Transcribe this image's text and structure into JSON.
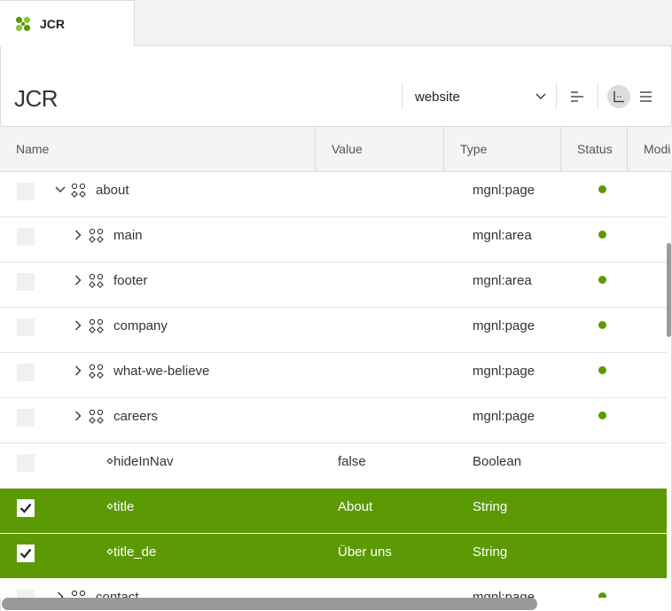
{
  "tab": {
    "label": "JCR"
  },
  "page": {
    "title": "JCR"
  },
  "toolbar": {
    "workspace": "website"
  },
  "columns": [
    "Name",
    "Value",
    "Type",
    "Status",
    "Modi"
  ],
  "rows": [
    {
      "name": "about",
      "value": "",
      "type": "mgnl:page",
      "status": true,
      "kind": "node",
      "level": 0,
      "expanded": true,
      "selected": false
    },
    {
      "name": "main",
      "value": "",
      "type": "mgnl:area",
      "status": true,
      "kind": "node",
      "level": 1,
      "expanded": false,
      "selected": false
    },
    {
      "name": "footer",
      "value": "",
      "type": "mgnl:area",
      "status": true,
      "kind": "node",
      "level": 1,
      "expanded": false,
      "selected": false
    },
    {
      "name": "company",
      "value": "",
      "type": "mgnl:page",
      "status": true,
      "kind": "node",
      "level": 1,
      "expanded": false,
      "selected": false
    },
    {
      "name": "what-we-believe",
      "value": "",
      "type": "mgnl:page",
      "status": true,
      "kind": "node",
      "level": 1,
      "expanded": false,
      "selected": false
    },
    {
      "name": "careers",
      "value": "",
      "type": "mgnl:page",
      "status": true,
      "kind": "node",
      "level": 1,
      "expanded": false,
      "selected": false
    },
    {
      "name": "hideInNav",
      "value": "false",
      "type": "Boolean",
      "status": false,
      "kind": "property",
      "level": 1,
      "selected": false
    },
    {
      "name": "title",
      "value": "About",
      "type": "String",
      "status": false,
      "kind": "property",
      "level": 1,
      "selected": true
    },
    {
      "name": "title_de",
      "value": "Über uns",
      "type": "String",
      "status": false,
      "kind": "property",
      "level": 1,
      "selected": true
    },
    {
      "name": "contact",
      "value": "",
      "type": "mgnl:page",
      "status": true,
      "kind": "node",
      "level": 0,
      "expanded": false,
      "selected": false
    }
  ],
  "colors": {
    "accent": "#5b9a04",
    "selected_row": "#5b9a04",
    "status_published": "#5b9a04"
  },
  "icons": {
    "app": "magnolia-logo-icon",
    "workspace_dropdown": "chevron-down-icon",
    "collapse": "collapse-tree-icon",
    "tree_view": "tree-view-icon",
    "list_view": "list-view-icon",
    "node": "node-icon",
    "property": "property-icon"
  }
}
